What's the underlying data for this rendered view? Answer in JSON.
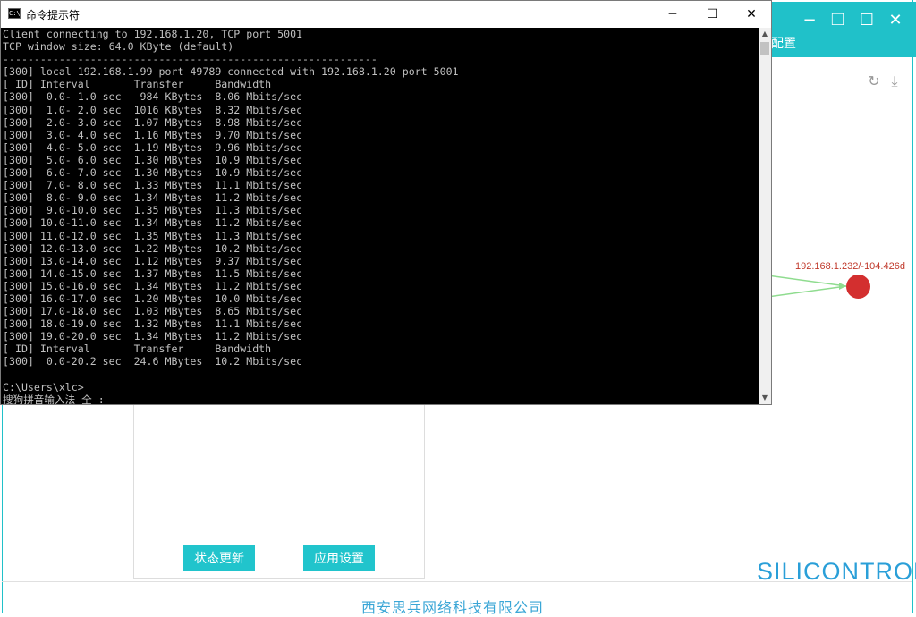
{
  "cmd": {
    "title": "命令提示符",
    "icon_text": "C:\\",
    "controls": {
      "minimize": "─",
      "maximize": "☐",
      "close": "✕"
    },
    "lines": [
      "Client connecting to 192.168.1.20, TCP port 5001",
      "TCP window size: 64.0 KByte (default)",
      "------------------------------------------------------------",
      "[300] local 192.168.1.99 port 49789 connected with 192.168.1.20 port 5001",
      "[ ID] Interval       Transfer     Bandwidth",
      "[300]  0.0- 1.0 sec   984 KBytes  8.06 Mbits/sec",
      "[300]  1.0- 2.0 sec  1016 KBytes  8.32 Mbits/sec",
      "[300]  2.0- 3.0 sec  1.07 MBytes  8.98 Mbits/sec",
      "[300]  3.0- 4.0 sec  1.16 MBytes  9.70 Mbits/sec",
      "[300]  4.0- 5.0 sec  1.19 MBytes  9.96 Mbits/sec",
      "[300]  5.0- 6.0 sec  1.30 MBytes  10.9 Mbits/sec",
      "[300]  6.0- 7.0 sec  1.30 MBytes  10.9 Mbits/sec",
      "[300]  7.0- 8.0 sec  1.33 MBytes  11.1 Mbits/sec",
      "[300]  8.0- 9.0 sec  1.34 MBytes  11.2 Mbits/sec",
      "[300]  9.0-10.0 sec  1.35 MBytes  11.3 Mbits/sec",
      "[300] 10.0-11.0 sec  1.34 MBytes  11.2 Mbits/sec",
      "[300] 11.0-12.0 sec  1.35 MBytes  11.3 Mbits/sec",
      "[300] 12.0-13.0 sec  1.22 MBytes  10.2 Mbits/sec",
      "[300] 13.0-14.0 sec  1.12 MBytes  9.37 Mbits/sec",
      "[300] 14.0-15.0 sec  1.37 MBytes  11.5 Mbits/sec",
      "[300] 15.0-16.0 sec  1.34 MBytes  11.2 Mbits/sec",
      "[300] 16.0-17.0 sec  1.20 MBytes  10.0 Mbits/sec",
      "[300] 17.0-18.0 sec  1.03 MBytes  8.65 Mbits/sec",
      "[300] 18.0-19.0 sec  1.32 MBytes  11.1 Mbits/sec",
      "[300] 19.0-20.0 sec  1.34 MBytes  11.2 Mbits/sec",
      "[ ID] Interval       Transfer     Bandwidth",
      "[300]  0.0-20.2 sec  24.6 MBytes  10.2 Mbits/sec",
      "",
      "C:\\Users\\xlc>",
      "搜狗拼音输入法 全 :"
    ],
    "scroll": {
      "up": "▲",
      "down": "▼"
    }
  },
  "app": {
    "window_controls": {
      "minimize": "−",
      "restore": "❐",
      "maximize": "☐",
      "close": "✕"
    },
    "tab_label": "配置",
    "tool_icons": {
      "refresh": "↻",
      "download": "⤓"
    },
    "topology": {
      "node_label": "192.168.1.232/-104.426d",
      "node_color": "#d32f2f",
      "link_color": "#8fdc8f"
    },
    "buttons": {
      "status_update": "状态更新",
      "apply_settings": "应用设置"
    },
    "footer": "西安思兵网络科技有限公司",
    "brand_color": "#20c1c9"
  },
  "logo": {
    "text": "SILICONTROL"
  }
}
